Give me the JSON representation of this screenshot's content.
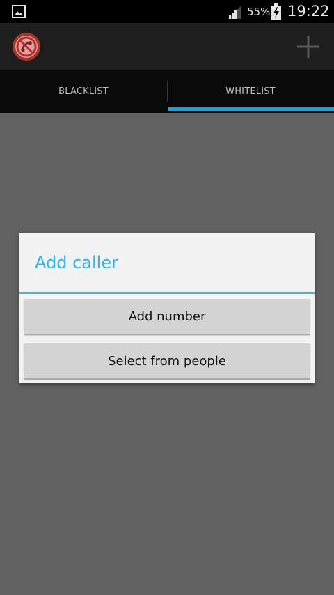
{
  "status_bar": {
    "battery_percent": "55%",
    "time": "19:22",
    "icons": [
      "gallery-icon",
      "signal-icon",
      "battery-charging-icon"
    ]
  },
  "action_bar": {
    "logo_icon": "call-blocker-logo-icon",
    "add_icon": "plus-icon"
  },
  "tabs": [
    {
      "label": "BLACKLIST",
      "selected": false
    },
    {
      "label": "WHITELIST",
      "selected": true
    }
  ],
  "dialog": {
    "title": "Add caller",
    "buttons": [
      {
        "label": "Add number"
      },
      {
        "label": "Select from people"
      }
    ]
  },
  "colors": {
    "accent": "#33b5e5",
    "dim_background": "#626262",
    "dialog_background": "#f2f2f2",
    "button_background": "#d3d3d3"
  }
}
